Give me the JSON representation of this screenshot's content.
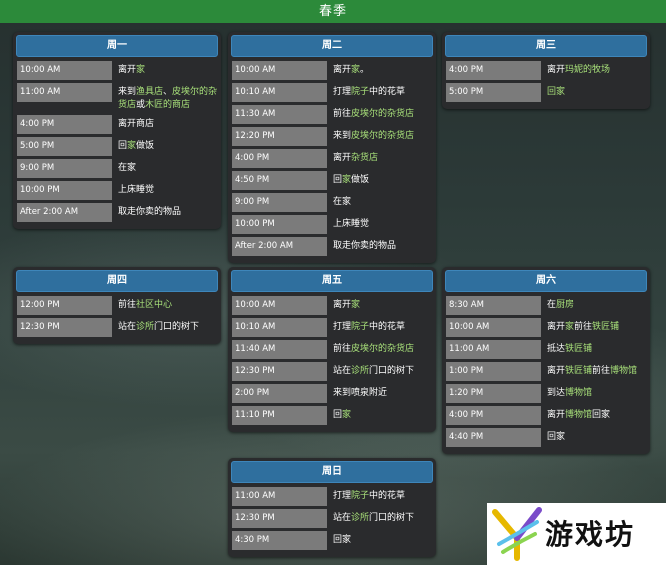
{
  "title": "春季",
  "colors": {
    "title_bar": "#2c8a3a",
    "header": "#2f6f9e",
    "highlight": "#a8e07a"
  },
  "days": {
    "mon": {
      "name": "周一",
      "rows": [
        {
          "time": "10:00 AM",
          "parts": [
            {
              "t": "离开"
            },
            {
              "t": "家",
              "hl": true
            }
          ]
        },
        {
          "time": "11:00 AM",
          "parts": [
            {
              "t": "来到"
            },
            {
              "t": "渔具店",
              "hl": true
            },
            {
              "t": "、"
            },
            {
              "t": "皮埃尔的杂货店",
              "hl": true
            },
            {
              "t": "或"
            },
            {
              "t": "木匠的商店",
              "hl": true
            }
          ]
        },
        {
          "time": "4:00 PM",
          "parts": [
            {
              "t": "离开商店"
            }
          ]
        },
        {
          "time": "5:00 PM",
          "parts": [
            {
              "t": "回"
            },
            {
              "t": "家",
              "hl": true
            },
            {
              "t": "做饭"
            }
          ]
        },
        {
          "time": "9:00 PM",
          "parts": [
            {
              "t": "在家"
            }
          ]
        },
        {
          "time": "10:00 PM",
          "parts": [
            {
              "t": "上床睡觉"
            }
          ]
        },
        {
          "time": "After 2:00 AM",
          "parts": [
            {
              "t": "取走你卖的物品"
            }
          ]
        }
      ]
    },
    "tue": {
      "name": "周二",
      "rows": [
        {
          "time": "10:00 AM",
          "parts": [
            {
              "t": "离开"
            },
            {
              "t": "家",
              "hl": true
            },
            {
              "t": "。"
            }
          ]
        },
        {
          "time": "10:10 AM",
          "parts": [
            {
              "t": "打理"
            },
            {
              "t": "院子",
              "hl": true
            },
            {
              "t": "中的花草"
            }
          ]
        },
        {
          "time": "11:30 AM",
          "parts": [
            {
              "t": "前往"
            },
            {
              "t": "皮埃尔的杂货店",
              "hl": true
            }
          ]
        },
        {
          "time": "12:20 PM",
          "parts": [
            {
              "t": "来到"
            },
            {
              "t": "皮埃尔的杂货店",
              "hl": true
            }
          ]
        },
        {
          "time": "4:00 PM",
          "parts": [
            {
              "t": "离开"
            },
            {
              "t": "杂货店",
              "hl": true
            }
          ]
        },
        {
          "time": "4:50 PM",
          "parts": [
            {
              "t": "回"
            },
            {
              "t": "家",
              "hl": true
            },
            {
              "t": "做饭"
            }
          ]
        },
        {
          "time": "9:00 PM",
          "parts": [
            {
              "t": "在家"
            }
          ]
        },
        {
          "time": "10:00 PM",
          "parts": [
            {
              "t": "上床睡觉"
            }
          ]
        },
        {
          "time": "After 2:00 AM",
          "parts": [
            {
              "t": "取走你卖的物品"
            }
          ]
        }
      ]
    },
    "wed": {
      "name": "周三",
      "rows": [
        {
          "time": "4:00 PM",
          "parts": [
            {
              "t": "离开"
            },
            {
              "t": "玛妮的牧场",
              "hl": true
            }
          ]
        },
        {
          "time": "5:00 PM",
          "parts": [
            {
              "t": "回家",
              "hl": true
            }
          ]
        }
      ]
    },
    "thu": {
      "name": "周四",
      "rows": [
        {
          "time": "12:00 PM",
          "parts": [
            {
              "t": "前往"
            },
            {
              "t": "社区中心",
              "hl": true
            }
          ]
        },
        {
          "time": "12:30 PM",
          "parts": [
            {
              "t": "站在"
            },
            {
              "t": "诊所",
              "hl": true
            },
            {
              "t": "门口的树下"
            }
          ]
        }
      ]
    },
    "fri": {
      "name": "周五",
      "rows": [
        {
          "time": "10:00 AM",
          "parts": [
            {
              "t": "离开"
            },
            {
              "t": "家",
              "hl": true
            }
          ]
        },
        {
          "time": "10:10 AM",
          "parts": [
            {
              "t": "打理"
            },
            {
              "t": "院子",
              "hl": true
            },
            {
              "t": "中的花草"
            }
          ]
        },
        {
          "time": "11:40 AM",
          "parts": [
            {
              "t": "前往"
            },
            {
              "t": "皮埃尔的杂货店",
              "hl": true
            }
          ]
        },
        {
          "time": "12:30 PM",
          "parts": [
            {
              "t": "站在"
            },
            {
              "t": "诊所",
              "hl": true
            },
            {
              "t": "门口的树下"
            }
          ]
        },
        {
          "time": "2:00 PM",
          "parts": [
            {
              "t": "来到喷泉附近"
            }
          ]
        },
        {
          "time": "11:10 PM",
          "parts": [
            {
              "t": "回"
            },
            {
              "t": "家",
              "hl": true
            }
          ]
        }
      ]
    },
    "sat": {
      "name": "周六",
      "rows": [
        {
          "time": "8:30 AM",
          "parts": [
            {
              "t": "在"
            },
            {
              "t": "厨房",
              "hl": true
            }
          ]
        },
        {
          "time": "10:00 AM",
          "parts": [
            {
              "t": "离开"
            },
            {
              "t": "家",
              "hl": true
            },
            {
              "t": "前往"
            },
            {
              "t": "铁匠铺",
              "hl": true
            }
          ]
        },
        {
          "time": "11:00 AM",
          "parts": [
            {
              "t": "抵达"
            },
            {
              "t": "铁匠铺",
              "hl": true
            }
          ]
        },
        {
          "time": "1:00 PM",
          "parts": [
            {
              "t": "离开"
            },
            {
              "t": "铁匠铺",
              "hl": true
            },
            {
              "t": "前往"
            },
            {
              "t": "博物馆",
              "hl": true
            }
          ]
        },
        {
          "time": "1:20 PM",
          "parts": [
            {
              "t": "到达"
            },
            {
              "t": "博物馆",
              "hl": true
            }
          ]
        },
        {
          "time": "4:00 PM",
          "parts": [
            {
              "t": "离开"
            },
            {
              "t": "博物馆",
              "hl": true
            },
            {
              "t": "回家"
            }
          ]
        },
        {
          "time": "4:40 PM",
          "parts": [
            {
              "t": "回家"
            }
          ]
        }
      ]
    },
    "sun": {
      "name": "周日",
      "rows": [
        {
          "time": "11:00 AM",
          "parts": [
            {
              "t": "打理"
            },
            {
              "t": "院子",
              "hl": true
            },
            {
              "t": "中的花草"
            }
          ]
        },
        {
          "time": "12:30 PM",
          "parts": [
            {
              "t": "站在"
            },
            {
              "t": "诊所",
              "hl": true
            },
            {
              "t": "门口的树下"
            }
          ]
        },
        {
          "time": "4:30 PM",
          "parts": [
            {
              "t": "回家"
            }
          ]
        }
      ]
    }
  },
  "watermark": {
    "text": "游戏坊"
  }
}
